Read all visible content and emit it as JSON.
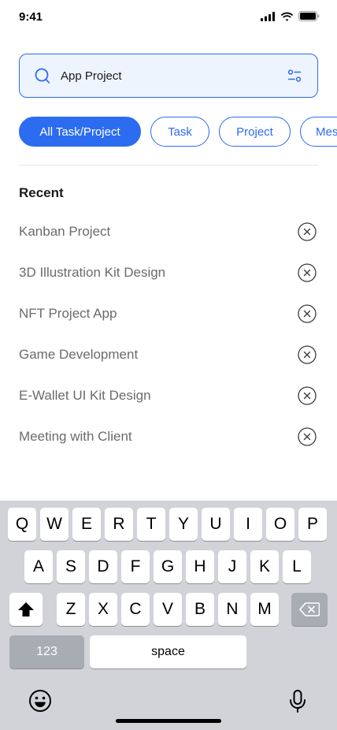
{
  "status_bar": {
    "time": "9:41",
    "icons": [
      "signal-icon",
      "wifi-icon",
      "battery-icon"
    ]
  },
  "search": {
    "value": "App Project",
    "icon": "search-icon",
    "filter_icon": "filter-icon"
  },
  "filters": [
    {
      "label": "All Task/Project",
      "active": true
    },
    {
      "label": "Task",
      "active": false
    },
    {
      "label": "Project",
      "active": false
    },
    {
      "label": "Mes",
      "active": false
    }
  ],
  "recent": {
    "title": "Recent",
    "items": [
      {
        "label": "Kanban Project"
      },
      {
        "label": "3D Illustration Kit Design"
      },
      {
        "label": "NFT Project App"
      },
      {
        "label": "Game Development"
      },
      {
        "label": "E-Wallet UI Kit Design"
      },
      {
        "label": "Meeting with Client"
      }
    ]
  },
  "keyboard": {
    "row1": [
      "Q",
      "W",
      "E",
      "R",
      "T",
      "Y",
      "U",
      "I",
      "O",
      "P"
    ],
    "row2": [
      "A",
      "S",
      "D",
      "F",
      "G",
      "H",
      "J",
      "K",
      "L"
    ],
    "row3": [
      "Z",
      "X",
      "C",
      "V",
      "B",
      "N",
      "M"
    ],
    "numbers_label": "123",
    "space_label": "space"
  },
  "colors": {
    "accent": "#2c6cf0",
    "search_bg": "#eef4fd",
    "keyboard_bg": "#d1d3d9"
  }
}
